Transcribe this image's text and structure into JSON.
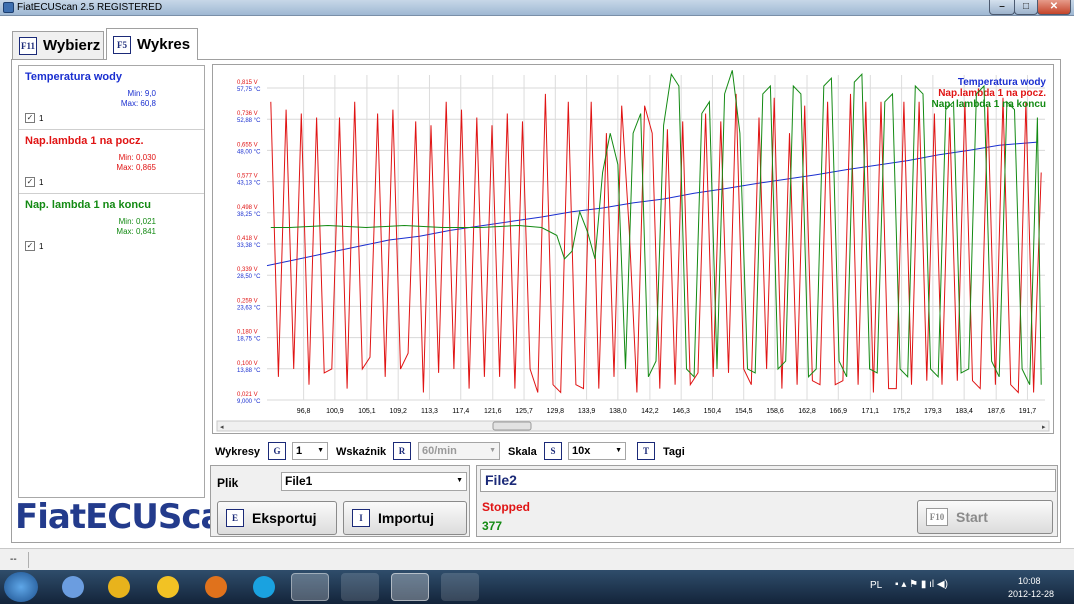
{
  "window": {
    "title": "FiatECUScan 2.5 REGISTERED",
    "min": "–",
    "max": "□",
    "close": "✕"
  },
  "tabs": [
    {
      "key": "F11",
      "label": "Wybierz"
    },
    {
      "key": "F5",
      "label": "Wykres"
    }
  ],
  "channels": [
    {
      "name": "Temperatura wody",
      "min": "Min: 9,0",
      "max": "Max: 60,8",
      "check": "1",
      "color": "#1a2fd0"
    },
    {
      "name": "Nap.lambda 1 na pocz.",
      "min": "Min: 0,030",
      "max": "Max: 0,865",
      "check": "1",
      "color": "#e01414"
    },
    {
      "name": "Nap. lambda 1 na koncu",
      "min": "Min: 0,021",
      "max": "Max: 0,841",
      "check": "1",
      "color": "#138a13"
    }
  ],
  "logo": "FiatECUScan",
  "chart_data": {
    "type": "line",
    "legend_position": "top-right",
    "grid": true,
    "x_ticks": [
      "96,8",
      "100,9",
      "105,1",
      "109,2",
      "113,3",
      "117,4",
      "121,6",
      "125,7",
      "129,8",
      "133,9",
      "138,0",
      "142,2",
      "146,3",
      "150,4",
      "154,5",
      "158,6",
      "162,8",
      "166,9",
      "171,1",
      "175,2",
      "179,3",
      "183,4",
      "187,6",
      "191,7"
    ],
    "y_ticks_voltage": [
      "0,021 V",
      "0,100 V",
      "0,180 V",
      "0,259 V",
      "0,339 V",
      "0,418 V",
      "0,498 V",
      "0,577 V",
      "0,655 V",
      "0,736 V",
      "0,815 V"
    ],
    "y_ticks_temp": [
      "9,000 °C",
      "13,88 °C",
      "18,75 °C",
      "23,63 °C",
      "28,50 °C",
      "33,38 °C",
      "38,25 °C",
      "43,13 °C",
      "48,00 °C",
      "52,88 °C",
      "57,75 °C"
    ],
    "series": [
      {
        "name": "Temperatura wody",
        "color": "#1a2fd0",
        "x": [
          92,
          96,
          100,
          104,
          108,
          112,
          116,
          120,
          124,
          128,
          132,
          136,
          140,
          144,
          148,
          152,
          156,
          160,
          164,
          168,
          172,
          176,
          180,
          184,
          188,
          193
        ],
        "y": [
          30.0,
          31.0,
          32.0,
          33.0,
          34.0,
          34.6,
          35.5,
          36.2,
          36.9,
          37.6,
          38.4,
          39.0,
          39.8,
          40.4,
          41.3,
          42.0,
          42.8,
          43.5,
          44.2,
          45.0,
          45.7,
          46.4,
          47.3,
          48.0,
          48.8,
          49.3
        ]
      },
      {
        "name": "Nap.lambda 1 na pocz.",
        "color": "#e01414",
        "x": [
          92.5,
          93.5,
          94.5,
          95.5,
          96.5,
          97.5,
          98.5,
          99.5,
          100.5,
          101.5,
          102.5,
          103.5,
          104.5,
          105.5,
          106.5,
          107.5,
          108.5,
          109.5,
          110.5,
          111.5,
          112.5,
          113.5,
          114.5,
          115.5,
          116.5,
          117.5,
          118.5,
          119.5,
          120.5,
          121.5,
          122.5,
          123.5,
          124.5,
          125.5,
          126.5,
          127.5,
          128.5,
          129.5,
          130.5,
          131.5,
          132.5,
          133.5,
          134.5,
          135.5,
          136.5,
          137.5,
          138.5,
          139.5,
          140.5,
          141.5,
          142.5,
          143.5,
          144.5,
          145.5,
          146.5,
          147.5,
          148.5,
          149.5,
          150.5,
          151.5,
          152.5,
          153.5,
          154.5,
          155.5,
          156.5,
          157.5,
          158.5,
          159.5,
          160.5,
          161.5,
          162.5,
          163.5,
          164.5,
          165.5,
          166.5,
          167.5,
          168.5,
          169.5,
          170.5,
          171.5,
          172.5,
          173.5,
          174.5,
          175.5,
          176.5,
          177.5,
          178.5,
          179.5,
          180.5,
          181.5,
          182.5,
          183.5,
          184.5,
          185.5,
          186.5,
          187.5,
          188.5,
          189.5,
          190.5,
          191.5,
          192.5,
          193.5
        ],
        "y": [
          0.78,
          0.08,
          0.76,
          0.1,
          0.75,
          0.06,
          0.74,
          0.09,
          0.1,
          0.74,
          0.05,
          0.78,
          0.1,
          0.13,
          0.75,
          0.08,
          0.76,
          0.1,
          0.14,
          0.73,
          0.04,
          0.72,
          0.09,
          0.78,
          0.1,
          0.76,
          0.05,
          0.74,
          0.08,
          0.72,
          0.08,
          0.75,
          0.05,
          0.73,
          0.1,
          0.04,
          0.8,
          0.06,
          0.04,
          0.78,
          0.06,
          0.05,
          0.78,
          0.05,
          0.7,
          0.08,
          0.77,
          0.45,
          0.04,
          0.77,
          0.7,
          0.05,
          0.71,
          0.06,
          0.73,
          0.06,
          0.09,
          0.75,
          0.08,
          0.73,
          0.09,
          0.8,
          0.1,
          0.06,
          0.74,
          0.1,
          0.79,
          0.05,
          0.7,
          0.06,
          0.77,
          0.07,
          0.06,
          0.78,
          0.06,
          0.07,
          0.8,
          0.06,
          0.78,
          0.04,
          0.78,
          0.05,
          0.05,
          0.78,
          0.06,
          0.78,
          0.07,
          0.75,
          0.06,
          0.74,
          0.07,
          0.78,
          0.07,
          0.05,
          0.77,
          0.06,
          0.79,
          0.06,
          0.04,
          0.78,
          0.04,
          0.6
        ]
      },
      {
        "name": "Nap. lambda 1 na koncu",
        "color": "#138a13",
        "x": [
          92.5,
          95,
          100,
          105,
          110,
          115,
          120,
          125,
          128,
          130,
          131,
          132,
          133,
          134,
          135,
          136,
          137,
          138,
          139,
          140,
          141,
          142,
          143,
          144,
          145,
          146,
          147,
          148,
          149,
          150,
          151,
          152,
          153,
          154,
          155,
          156,
          157,
          158,
          159,
          160,
          161,
          162,
          163,
          164,
          165,
          166,
          167,
          168,
          169,
          170,
          171,
          172,
          173,
          174,
          175,
          176,
          177,
          178,
          179,
          180,
          181,
          182,
          183,
          184,
          185,
          186,
          187,
          188,
          189,
          190,
          191,
          192,
          193,
          193.5
        ],
        "y": [
          0.46,
          0.46,
          0.465,
          0.46,
          0.465,
          0.46,
          0.46,
          0.465,
          0.46,
          0.44,
          0.38,
          0.4,
          0.5,
          0.45,
          0.38,
          0.6,
          0.7,
          0.62,
          0.1,
          0.7,
          0.75,
          0.08,
          0.12,
          0.72,
          0.85,
          0.82,
          0.1,
          0.08,
          0.75,
          0.78,
          0.1,
          0.8,
          0.86,
          0.7,
          0.1,
          0.09,
          0.8,
          0.82,
          0.1,
          0.12,
          0.82,
          0.8,
          0.08,
          0.1,
          0.82,
          0.84,
          0.12,
          0.08,
          0.83,
          0.85,
          0.1,
          0.09,
          0.78,
          0.8,
          0.1,
          0.08,
          0.82,
          0.8,
          0.1,
          0.08,
          0.76,
          0.78,
          0.09,
          0.1,
          0.8,
          0.82,
          0.12,
          0.08,
          0.78,
          0.76,
          0.1,
          0.06,
          0.74,
          0.06
        ]
      }
    ]
  },
  "controls": {
    "wykresy_label": "Wykresy",
    "wykresy_key": "G",
    "wykresy_value": "1",
    "wskaznik_label": "Wskaźnik",
    "wskaznik_key": "R",
    "wskaznik_value": "60/min",
    "skala_label": "Skala",
    "skala_key": "S",
    "skala_value": "10x",
    "tagi_key": "T",
    "tagi_label": "Tagi"
  },
  "file": {
    "label": "Plik",
    "value": "File1",
    "export_key": "E",
    "export_label": "Eksportuj",
    "import_key": "I",
    "import_label": "Importuj"
  },
  "status": {
    "filename": "File2",
    "state": "Stopped",
    "count": "377",
    "start_key": "F10",
    "start_label": "Start"
  },
  "statusbar": {
    "text": "--"
  },
  "taskbar": {
    "lang": "PL",
    "time": "10:08",
    "date": "2012-12-28"
  }
}
